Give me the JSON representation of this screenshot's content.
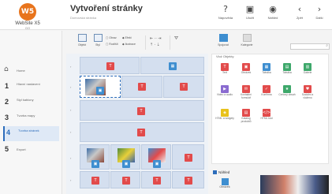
{
  "app": {
    "logo_initials": "W5",
    "logo_name": "WebSite X5",
    "logo_edition": "GO",
    "brand_color": "#e8741c"
  },
  "header": {
    "title": "Vytvoření stránky",
    "subtitle": "Domovská stránka",
    "buttons": [
      {
        "label": "Nápověda",
        "icon": "help-icon"
      },
      {
        "label": "Uložit",
        "icon": "save-icon"
      },
      {
        "label": "Náhled",
        "icon": "eye-icon"
      },
      {
        "label": "Zpět",
        "icon": "back-icon"
      },
      {
        "label": "Další",
        "icon": "next-icon"
      }
    ]
  },
  "sidebar": {
    "items": [
      {
        "num": "",
        "label": "Home",
        "icon": "home-icon"
      },
      {
        "num": "1",
        "label": "Hlavní nastavení"
      },
      {
        "num": "2",
        "label": "Styl šablony"
      },
      {
        "num": "3",
        "label": "Tvorba mapy"
      },
      {
        "num": "4",
        "label": "Tvorba stránek",
        "active": true
      },
      {
        "num": "5",
        "label": "Export"
      }
    ],
    "accent": "#2d6dbb"
  },
  "toolbar": {
    "objekt_label": "Objekt",
    "styl_label": "Styl",
    "obraz_label": "Obraz",
    "efekt_label": "Efekt",
    "rozlisit_label": "Rozlišit",
    "ilustrace_label": "Ilustrace",
    "spojovat_label": "Spojovat",
    "kategorie_label": "Kategorie"
  },
  "panel": {
    "title": "Vlož Objekty",
    "objects": [
      {
        "label": "Text",
        "color": "#e24b4b"
      },
      {
        "label": "Obrázek",
        "color": "#e24b4b"
      },
      {
        "label": "Tabulka",
        "color": "#3e8ed0"
      },
      {
        "label": "Tabulka",
        "color": "#3ea86b"
      },
      {
        "label": "Galerie",
        "color": "#3ea86b"
      },
      {
        "label": "Video a audio",
        "color": "#8a6bd0"
      },
      {
        "label": "Kontaktní formulář",
        "color": "#e24b4b"
      },
      {
        "label": "Konfirma",
        "color": "#e24b4b"
      },
      {
        "label": "Certový obsah",
        "color": "#3ea86b"
      },
      {
        "label": "Sociální a vloženo",
        "color": "#e24b4b"
      },
      {
        "label": "HTML a widgety",
        "color": "#e8c21c"
      },
      {
        "label": "Katalog produktů",
        "color": "#e24b4b"
      },
      {
        "label": "HTML kód",
        "color": "#e24b4b"
      }
    ]
  },
  "preview": {
    "checkbox_label": "Náhled",
    "button_label": "Obrázek"
  }
}
